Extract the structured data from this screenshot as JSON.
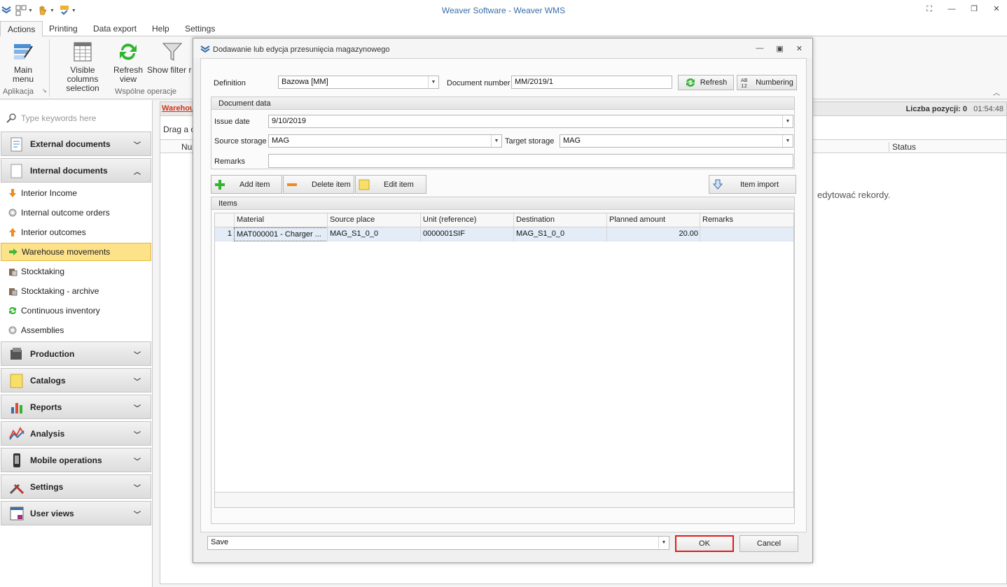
{
  "window": {
    "title": "Weaver Software - Weaver WMS"
  },
  "ribbon_tabs": [
    "Actions",
    "Printing",
    "Data export",
    "Help",
    "Settings"
  ],
  "ribbon": {
    "main_menu": "Main menu",
    "visible_columns_1": "Visible columns",
    "visible_columns_2": "selection",
    "refresh_1": "Refresh",
    "refresh_2": "view",
    "show_filter": "Show filter ro",
    "group_aplikacja": "Aplikacja",
    "group_wspolne": "Wspólne operacje"
  },
  "nav": {
    "search_placeholder": "Type keywords here",
    "groups": {
      "external": "External documents",
      "internal": "Internal documents",
      "production": "Production",
      "catalogs": "Catalogs",
      "reports": "Reports",
      "analysis": "Analysis",
      "mobile": "Mobile operations",
      "settings": "Settings",
      "userviews": "User views"
    },
    "items": [
      "Interior Income",
      "Internal outcome orders",
      "Interior outcomes",
      "Warehouse movements",
      "Stocktaking",
      "Stocktaking - archive",
      "Continuous inventory",
      "Assemblies"
    ]
  },
  "background": {
    "tab": "Warehou",
    "count": "Liczba pozycji: 0",
    "time": "01:54:48",
    "drag": "Drag a c",
    "col_nu": "Nu",
    "col_status": "Status",
    "message": "edytować rekordy."
  },
  "dialog": {
    "title": "Dodawanie lub edycja przesunięcia magazynowego",
    "definition_label": "Definition",
    "definition_value": "Bazowa [MM]",
    "docnum_label": "Document number",
    "docnum_value": "MM/2019/1",
    "refresh_btn": "Refresh",
    "numbering_btn": "Numbering",
    "docdata_header": "Document data",
    "issue_date_label": "Issue date",
    "issue_date_value": "9/10/2019",
    "source_label": "Source storage",
    "source_value": "MAG",
    "target_label": "Target storage",
    "target_value": "MAG",
    "remarks_label": "Remarks",
    "add_item": "Add item",
    "delete_item": "Delete item",
    "edit_item": "Edit item",
    "item_import": "Item import",
    "items_header": "Items",
    "columns": [
      "Material",
      "Source place",
      "Unit (reference)",
      "Destination",
      "Planned amount",
      "Remarks"
    ],
    "rows": [
      {
        "num": "1",
        "material": "MAT000001 - Charger ...",
        "source_place": "MAG_S1_0_0",
        "unit": "0000001SIF",
        "destination": "MAG_S1_0_0",
        "planned": "20.00",
        "remarks": ""
      }
    ],
    "save_value": "Save",
    "ok": "OK",
    "cancel": "Cancel"
  }
}
